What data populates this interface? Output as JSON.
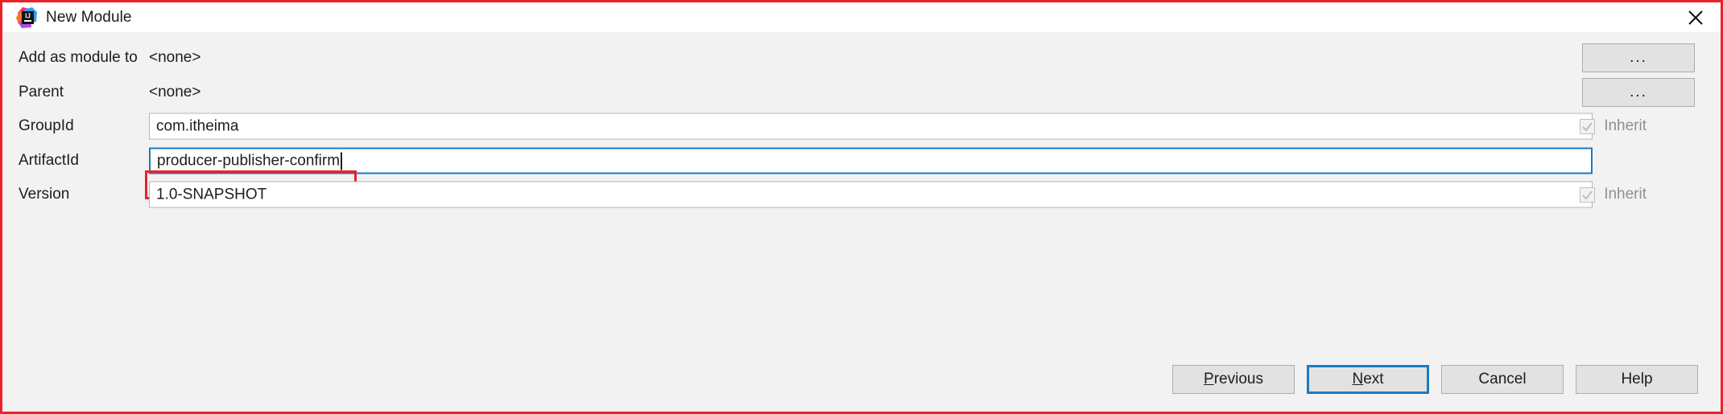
{
  "window": {
    "title": "New Module",
    "app_icon": "intellij-idea-icon",
    "close_label": "✕"
  },
  "form": {
    "rows": [
      {
        "label": "Add as module to",
        "type": "static",
        "value": "<none>",
        "browse_label": "...",
        "name": "add-as-module-to"
      },
      {
        "label": "Parent",
        "type": "static",
        "value": "<none>",
        "browse_label": "...",
        "name": "parent"
      },
      {
        "label": "GroupId",
        "type": "text",
        "value": "com.itheima",
        "inherit_label": "Inherit",
        "inherit_checked": true,
        "inherit_enabled": false,
        "name": "groupid"
      },
      {
        "label": "ArtifactId",
        "type": "text",
        "value": "producer-publisher-confirm",
        "focused": true,
        "annotated": true,
        "name": "artifactid"
      },
      {
        "label": "Version",
        "type": "text",
        "value": "1.0-SNAPSHOT",
        "inherit_label": "Inherit",
        "inherit_checked": true,
        "inherit_enabled": false,
        "name": "version"
      }
    ]
  },
  "buttons": {
    "previous": {
      "prefix": "",
      "mnemonic": "P",
      "suffix": "revious"
    },
    "next": {
      "prefix": "",
      "mnemonic": "N",
      "suffix": "ext"
    },
    "cancel": {
      "label": "Cancel"
    },
    "help": {
      "label": "Help"
    }
  },
  "colors": {
    "annotation": "#e8232a",
    "focus": "#1a7bc4",
    "panel": "#f2f2f2",
    "titlebar": "#ffffff",
    "button_face": "#e2e2e2",
    "text": "#1d1d1d",
    "disabled_text": "#8f8f8f"
  }
}
